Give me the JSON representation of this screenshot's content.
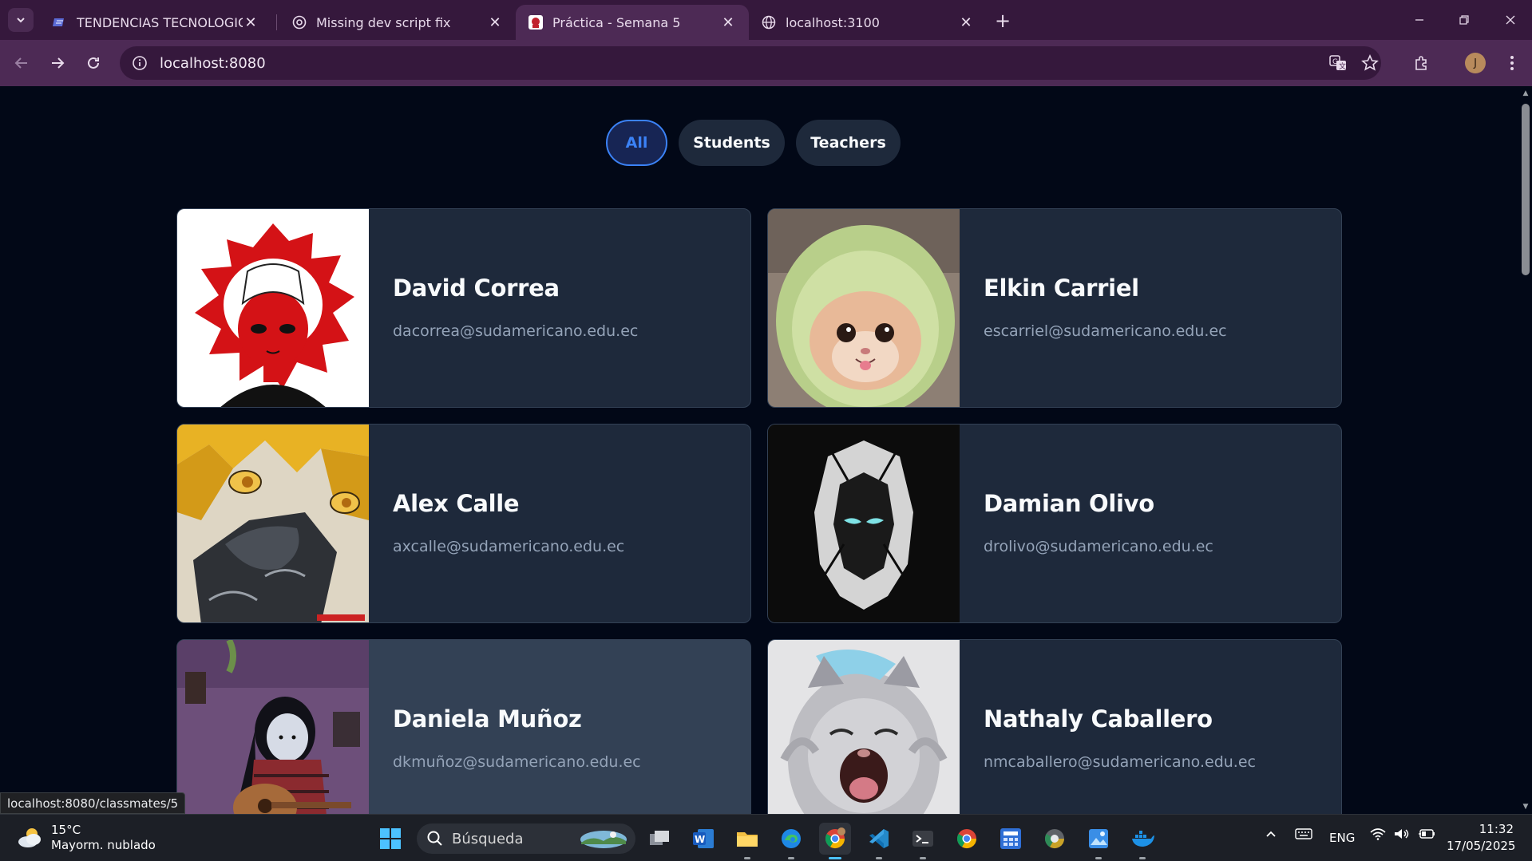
{
  "browser": {
    "tabs": [
      {
        "title": "TENDENCIAS TECNOLOGICAS -",
        "active": false
      },
      {
        "title": "Missing dev script fix",
        "active": false
      },
      {
        "title": "Práctica - Semana 5",
        "active": true
      },
      {
        "title": "localhost:3100",
        "active": false
      }
    ],
    "url": "localhost:8080",
    "profile_initial": "J",
    "status_url": "localhost:8080/classmates/5"
  },
  "filters": {
    "all": "All",
    "students": "Students",
    "teachers": "Teachers",
    "selected": "All"
  },
  "classmates": [
    {
      "name": "David Correa",
      "email": "dacorrea@sudamericano.edu.ec",
      "photo": "red-anime-character"
    },
    {
      "name": "Elkin Carriel",
      "email": "escarriel@sudamericano.edu.ec",
      "photo": "cat-in-avocado-hood"
    },
    {
      "name": "Alex Calle",
      "email": "axcalle@sudamericano.edu.ec",
      "photo": "anime-blond-character"
    },
    {
      "name": "Damian Olivo",
      "email": "drolivo@sudamericano.edu.ec",
      "photo": "moon-knight-logo"
    },
    {
      "name": "Daniela Muñoz",
      "email": "dkmuñoz@sudamericano.edu.ec",
      "photo": "cartoon-girl-guitar"
    },
    {
      "name": "Nathaly Caballero",
      "email": "nmcaballero@sudamericano.edu.ec",
      "photo": "screaming-cat"
    }
  ],
  "taskbar": {
    "weather_temp": "15°C",
    "weather_desc": "Mayorm. nublado",
    "search_placeholder": "Búsqueda",
    "language": "ENG",
    "time": "11:32",
    "date": "17/05/2025"
  },
  "colors": {
    "page_bg": "#020817",
    "card_bg": "#1e293b",
    "accent": "#3b82f6",
    "browser_frame": "#35183c"
  }
}
